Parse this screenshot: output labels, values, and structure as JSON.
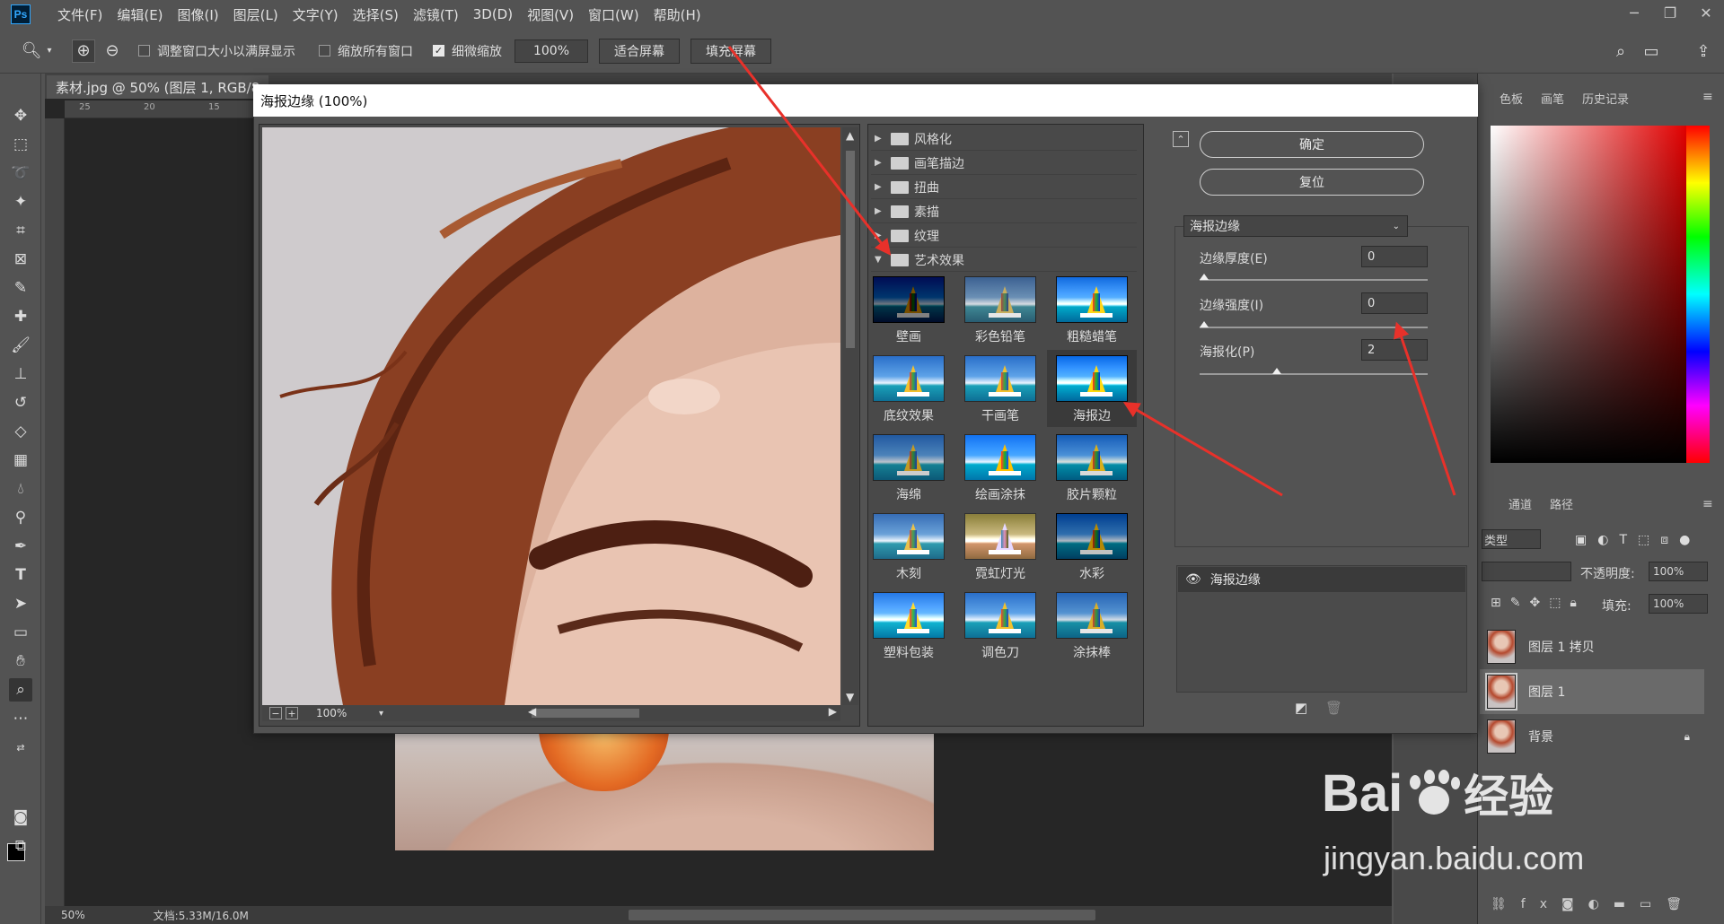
{
  "menubar": {
    "logo": "Ps",
    "items": [
      "文件(F)",
      "编辑(E)",
      "图像(I)",
      "图层(L)",
      "文字(Y)",
      "选择(S)",
      "滤镜(T)",
      "3D(D)",
      "视图(V)",
      "窗口(W)",
      "帮助(H)"
    ]
  },
  "options": {
    "resize_windows": "调整窗口大小以满屏显示",
    "zoom_all": "缩放所有窗口",
    "scrubby_zoom": "细微缩放",
    "zoom_value": "100%",
    "fit_screen": "适合屏幕",
    "fill_screen": "填充屏幕"
  },
  "document": {
    "tab_title": "素材.jpg @ 50% (图层 1, RGB/8"
  },
  "status": {
    "zoom": "50%",
    "doc_size": "文档:5.33M/16.0M"
  },
  "dialog": {
    "title": "海报边缘 (100%)",
    "preview_zoom": "100%",
    "folders": [
      "风格化",
      "画笔描边",
      "扭曲",
      "素描",
      "纹理",
      "艺术效果"
    ],
    "filters": [
      "壁画",
      "彩色铅笔",
      "粗糙蜡笔",
      "底纹效果",
      "干画笔",
      "海报边缘",
      "海绵",
      "绘画涂抹",
      "胶片颗粒",
      "木刻",
      "霓虹灯光",
      "水彩",
      "塑料包装",
      "调色刀",
      "涂抹棒"
    ],
    "selected_filter_label": "海报边",
    "ok": "确定",
    "reset": "复位",
    "filter_select": "海报边缘",
    "params": [
      {
        "label": "边缘厚度(E)",
        "value": "0",
        "level": 0
      },
      {
        "label": "边缘强度(I)",
        "value": "0",
        "level": 0
      },
      {
        "label": "海报化(P)",
        "value": "2",
        "level": 0.33
      }
    ],
    "effect_layer": "海报边缘"
  },
  "panels": {
    "top_tabs": [
      "色板",
      "画笔",
      "历史记录"
    ],
    "layer_tabs": [
      "通道",
      "路径"
    ],
    "kind_label": "类型",
    "opacity_label": "不透明度:",
    "opacity_value": "100%",
    "fill_label": "填充:",
    "fill_value": "100%",
    "layers": [
      "图层 1 拷贝",
      "图层 1",
      "背景"
    ]
  },
  "watermark": {
    "brand": "Bai",
    "brand2": "经验",
    "url": "jingyan.baidu.com"
  },
  "colors": {
    "accent": "#31a8ff",
    "arrow": "#e8312a"
  }
}
